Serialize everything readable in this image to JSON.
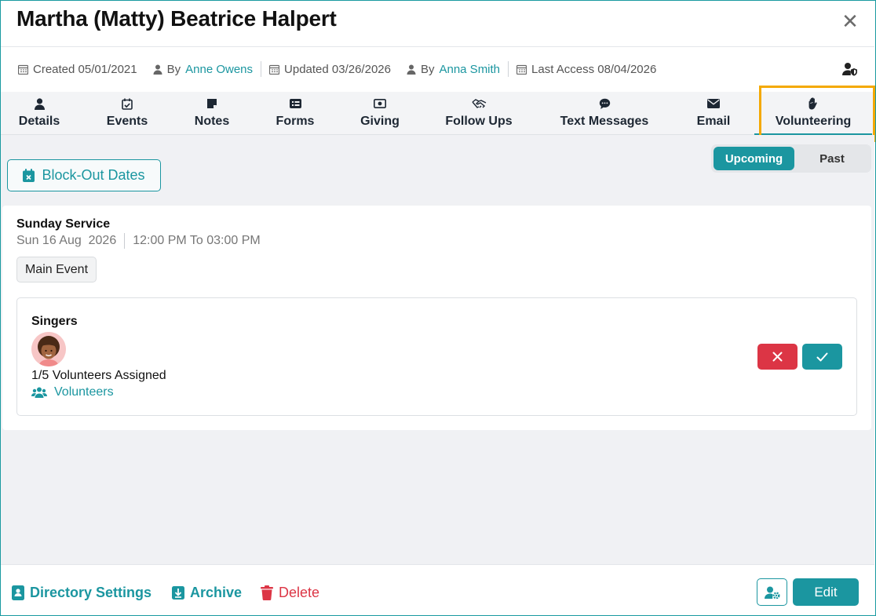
{
  "header": {
    "title": "Martha (Matty) Beatrice Halpert",
    "close_glyph": "✕"
  },
  "meta": {
    "created_label": "Created 05/01/2021",
    "created_by_prefix": "By",
    "created_by": "Anne Owens",
    "updated_label": "Updated 03/26/2026",
    "updated_by_prefix": "By",
    "updated_by": "Anna Smith",
    "last_access_label": "Last Access 08/04/2026"
  },
  "tabs": [
    {
      "label": "Details",
      "icon": "user-icon"
    },
    {
      "label": "Events",
      "icon": "calendar-check-icon"
    },
    {
      "label": "Notes",
      "icon": "sticky-note-icon"
    },
    {
      "label": "Forms",
      "icon": "form-list-icon"
    },
    {
      "label": "Giving",
      "icon": "money-bill-icon"
    },
    {
      "label": "Follow Ups",
      "icon": "handshake-icon"
    },
    {
      "label": "Text Messages",
      "icon": "chat-bubble-icon"
    },
    {
      "label": "Email",
      "icon": "envelope-icon"
    },
    {
      "label": "Volunteering",
      "icon": "hand-icon",
      "active": true
    }
  ],
  "toolbar": {
    "blockout_label": "Block-Out Dates",
    "segment": {
      "upcoming": "Upcoming",
      "past": "Past",
      "selected": "Upcoming"
    }
  },
  "event": {
    "title": "Sunday Service",
    "date": "Sun 16 Aug  2026",
    "time": "12:00 PM To 03:00 PM",
    "badge": "Main Event",
    "role": {
      "name": "Singers",
      "assigned": "1/5 Volunteers Assigned",
      "volunteers_link": "Volunteers"
    }
  },
  "footer": {
    "directory_settings": "Directory Settings",
    "archive": "Archive",
    "delete": "Delete",
    "edit": "Edit"
  },
  "colors": {
    "accent": "#1b96a0",
    "danger": "#dc3545",
    "highlight": "#f4a900"
  }
}
